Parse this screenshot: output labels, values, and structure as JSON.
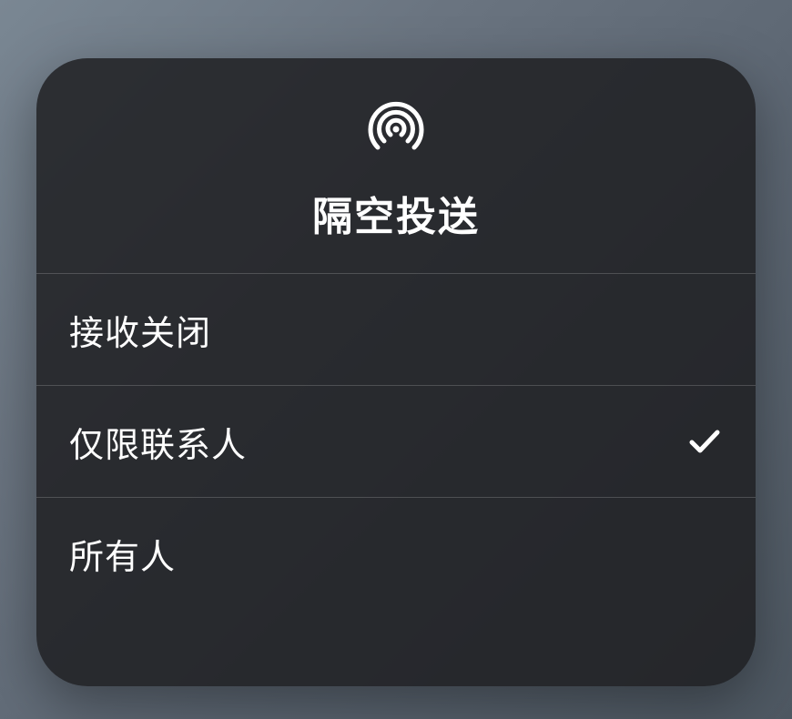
{
  "panel": {
    "title": "隔空投送",
    "options": [
      {
        "label": "接收关闭",
        "selected": false
      },
      {
        "label": "仅限联系人",
        "selected": true
      },
      {
        "label": "所有人",
        "selected": false
      }
    ]
  }
}
